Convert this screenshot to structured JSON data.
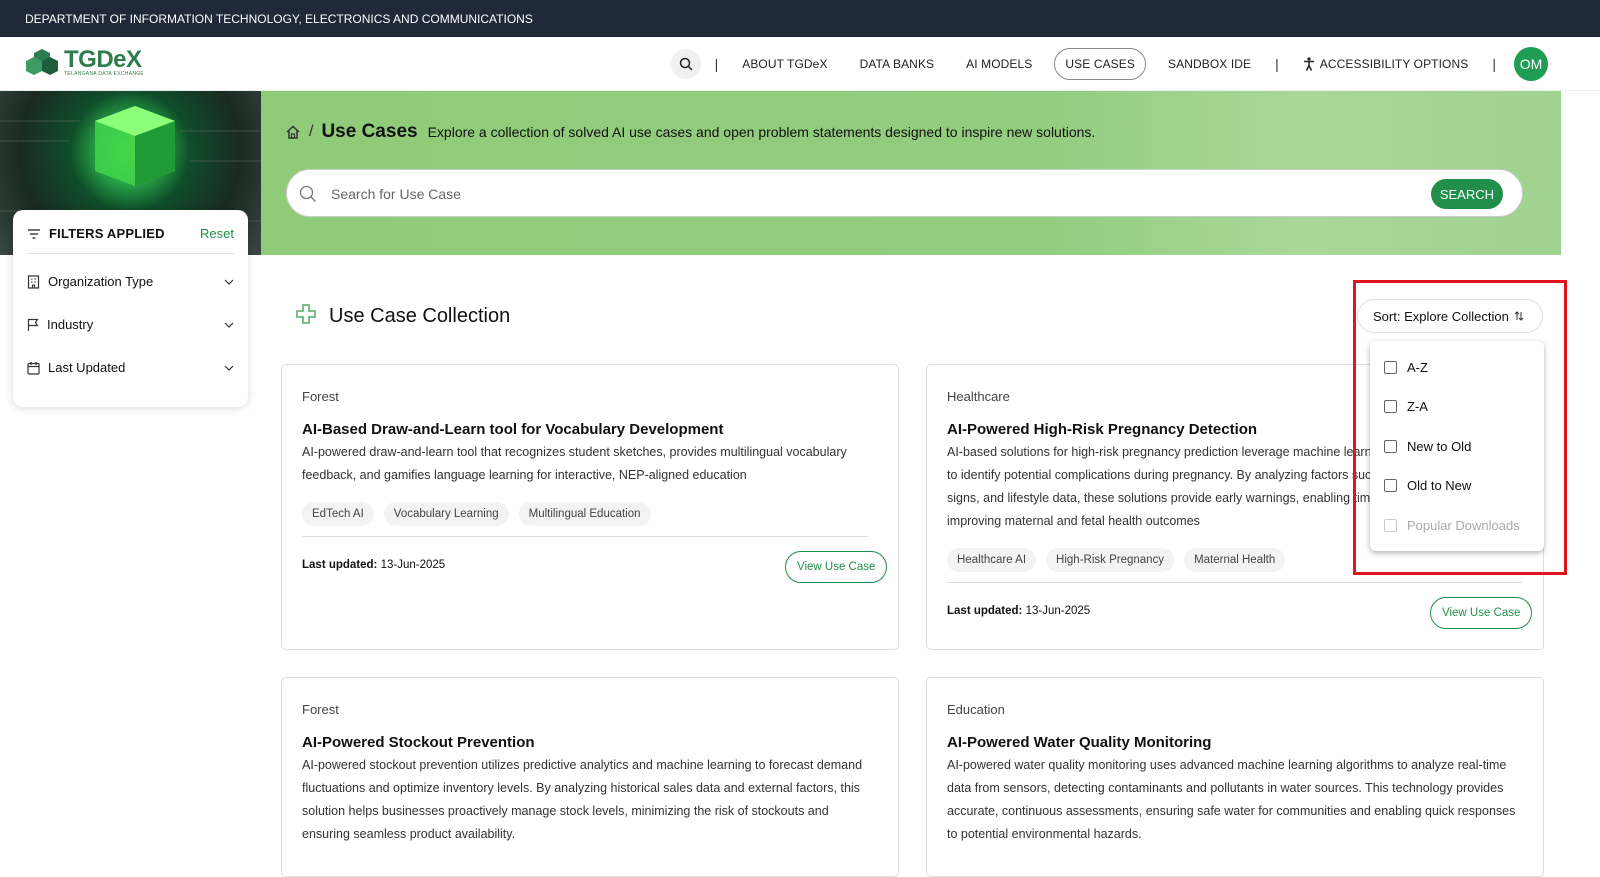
{
  "topbar": {
    "text": "DEPARTMENT OF INFORMATION TECHNOLOGY, ELECTRONICS AND COMMUNICATIONS"
  },
  "logo": {
    "name": "TGDeX",
    "tagline": "TELANGANA DATA EXCHANGE"
  },
  "nav": {
    "items": [
      "ABOUT TGDeX",
      "DATA BANKS",
      "AI MODELS",
      "USE CASES",
      "SANDBOX IDE"
    ],
    "active": "USE CASES",
    "accessibility": "ACCESSIBILITY OPTIONS",
    "avatar": "OM"
  },
  "hero": {
    "breadcrumb_sep": "/",
    "title": "Use Cases",
    "description": "Explore a collection of solved AI use cases and open problem statements designed to inspire new solutions.",
    "search_placeholder": "Search for Use Case",
    "search_button": "SEARCH"
  },
  "filters": {
    "title": "FILTERS APPLIED",
    "reset": "Reset",
    "items": [
      "Organization Type",
      "Industry",
      "Last Updated"
    ]
  },
  "collection": {
    "title": "Use Case Collection"
  },
  "sort": {
    "label": "Sort: Explore Collection",
    "options": [
      "A-Z",
      "Z-A",
      "New to Old",
      "Old to New",
      "Popular Downloads"
    ],
    "disabled_option": "Popular Downloads"
  },
  "cards": [
    {
      "category": "Forest",
      "title": "AI-Based Draw-and-Learn tool for Vocabulary Development",
      "description": "AI-powered draw-and-learn tool that recognizes student sketches, provides multilingual vocabulary feedback, and gamifies language learning for interactive, NEP-aligned education",
      "tags": [
        "EdTech AI",
        "Vocabulary Learning",
        "Multilingual Education"
      ],
      "updated_label": "Last updated:",
      "updated": "13-Jun-2025",
      "button": "View Use Case"
    },
    {
      "category": "Healthcare",
      "title": "AI-Powered High-Risk Pregnancy Detection",
      "description": "AI-based solutions for high-risk pregnancy prediction leverage machine learning to analyze patient data to identify potential complications during pregnancy. By analyzing factors such as medical history, vital signs, and lifestyle data, these solutions provide early warnings, enabling timely interventions and improving maternal and fetal health outcomes",
      "tags": [
        "Healthcare AI",
        "High-Risk Pregnancy",
        "Maternal Health"
      ],
      "updated_label": "Last updated:",
      "updated": "13-Jun-2025",
      "button": "View Use Case"
    },
    {
      "category": "Forest",
      "title": "AI-Powered Stockout Prevention",
      "description": "AI-powered stockout prevention utilizes predictive analytics and machine learning to forecast demand fluctuations and optimize inventory levels. By analyzing historical sales data and external factors, this solution helps businesses proactively manage stock levels, minimizing the risk of stockouts and ensuring seamless product availability."
    },
    {
      "category": "Education",
      "title": "AI-Powered Water Quality Monitoring",
      "description": "AI-powered water quality monitoring uses advanced machine learning algorithms to analyze real-time data from sensors, detecting contaminants and pollutants in water sources. This technology provides accurate, continuous assessments, ensuring safe water for communities and enabling quick responses to potential environmental hazards."
    }
  ],
  "colors": {
    "brand_green": "#1f8f4a",
    "hero_green": "#92cd7f",
    "topbar": "#1f2937",
    "highlight": "#e0141a"
  }
}
